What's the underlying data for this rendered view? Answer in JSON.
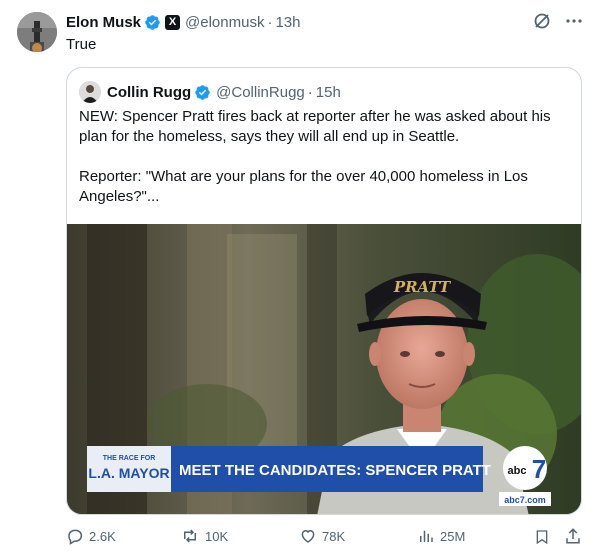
{
  "author": {
    "name": "Elon Musk",
    "handle": "@elonmusk",
    "time": "13h",
    "separator": "·",
    "badge_glyph": "X",
    "verified_icon": "verified-badge-icon"
  },
  "tweet_text": "True",
  "quoted": {
    "name": "Collin Rugg",
    "handle": "@CollinRugg",
    "time": "15h",
    "separator": "·",
    "text": "NEW: Spencer Pratt fires back at reporter after he was asked about his plan for the homeless, says they will all end up in Seattle.\n\nReporter: \"What are your plans for the over 40,000 homeless in Los Angeles?\"...",
    "media": {
      "lower_third": "MEET THE CANDIDATES: SPENCER PRATT",
      "race_label_top": "THE RACE FOR",
      "race_label_main": "L.A. MAYOR",
      "hat_text": "PRATT",
      "network": "abc",
      "channel_number": "7",
      "site": "abc7.com"
    }
  },
  "actions": {
    "replies": "2.6K",
    "reposts": "10K",
    "likes": "78K",
    "views": "25M"
  },
  "colors": {
    "text": "#0f1419",
    "muted": "#536471",
    "verified": "#1d9bf0",
    "border": "#cfd9de",
    "banner_blue": "#1f4fa8"
  }
}
